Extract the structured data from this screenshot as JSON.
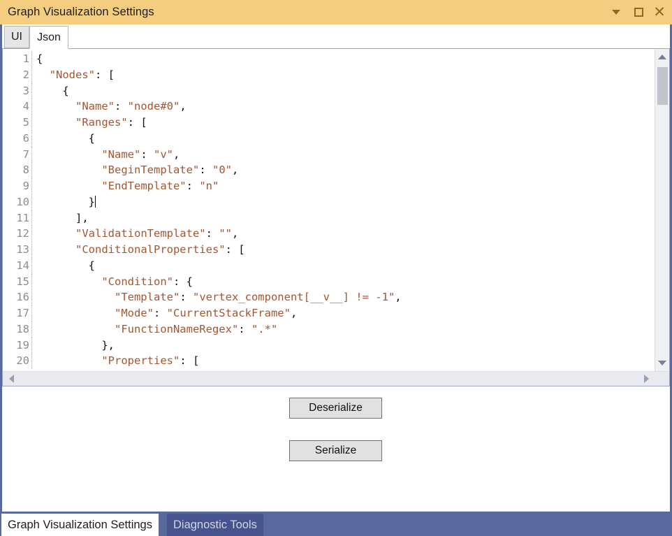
{
  "window": {
    "title": "Graph Visualization Settings",
    "controls": [
      {
        "name": "chevron-down-icon",
        "glyph": "▾"
      },
      {
        "name": "maximize-icon",
        "glyph": "□"
      },
      {
        "name": "close-icon",
        "glyph": "×"
      }
    ]
  },
  "tabs": {
    "items": [
      {
        "label": "UI",
        "active": false
      },
      {
        "label": "Json",
        "active": true
      }
    ]
  },
  "editor": {
    "lines": [
      {
        "num": "1",
        "segments": [
          {
            "t": "{",
            "k": "p"
          }
        ]
      },
      {
        "num": "2",
        "segments": [
          {
            "t": "  ",
            "k": "p"
          },
          {
            "t": "\"Nodes\"",
            "k": "s"
          },
          {
            "t": ": [",
            "k": "p"
          }
        ]
      },
      {
        "num": "3",
        "segments": [
          {
            "t": "    {",
            "k": "p"
          }
        ]
      },
      {
        "num": "4",
        "segments": [
          {
            "t": "      ",
            "k": "p"
          },
          {
            "t": "\"Name\"",
            "k": "s"
          },
          {
            "t": ": ",
            "k": "p"
          },
          {
            "t": "\"node#0\"",
            "k": "s"
          },
          {
            "t": ",",
            "k": "p"
          }
        ]
      },
      {
        "num": "5",
        "segments": [
          {
            "t": "      ",
            "k": "p"
          },
          {
            "t": "\"Ranges\"",
            "k": "s"
          },
          {
            "t": ": [",
            "k": "p"
          }
        ]
      },
      {
        "num": "6",
        "segments": [
          {
            "t": "        {",
            "k": "p"
          }
        ]
      },
      {
        "num": "7",
        "segments": [
          {
            "t": "          ",
            "k": "p"
          },
          {
            "t": "\"Name\"",
            "k": "s"
          },
          {
            "t": ": ",
            "k": "p"
          },
          {
            "t": "\"v\"",
            "k": "s"
          },
          {
            "t": ",",
            "k": "p"
          }
        ]
      },
      {
        "num": "8",
        "segments": [
          {
            "t": "          ",
            "k": "p"
          },
          {
            "t": "\"BeginTemplate\"",
            "k": "s"
          },
          {
            "t": ": ",
            "k": "p"
          },
          {
            "t": "\"0\"",
            "k": "s"
          },
          {
            "t": ",",
            "k": "p"
          }
        ]
      },
      {
        "num": "9",
        "segments": [
          {
            "t": "          ",
            "k": "p"
          },
          {
            "t": "\"EndTemplate\"",
            "k": "s"
          },
          {
            "t": ": ",
            "k": "p"
          },
          {
            "t": "\"n\"",
            "k": "s"
          }
        ]
      },
      {
        "num": "10",
        "segments": [
          {
            "t": "        }",
            "k": "p"
          }
        ],
        "caret": true
      },
      {
        "num": "11",
        "segments": [
          {
            "t": "      ],",
            "k": "p"
          }
        ]
      },
      {
        "num": "12",
        "segments": [
          {
            "t": "      ",
            "k": "p"
          },
          {
            "t": "\"ValidationTemplate\"",
            "k": "s"
          },
          {
            "t": ": ",
            "k": "p"
          },
          {
            "t": "\"\"",
            "k": "s"
          },
          {
            "t": ",",
            "k": "p"
          }
        ]
      },
      {
        "num": "13",
        "segments": [
          {
            "t": "      ",
            "k": "p"
          },
          {
            "t": "\"ConditionalProperties\"",
            "k": "s"
          },
          {
            "t": ": [",
            "k": "p"
          }
        ]
      },
      {
        "num": "14",
        "segments": [
          {
            "t": "        {",
            "k": "p"
          }
        ]
      },
      {
        "num": "15",
        "segments": [
          {
            "t": "          ",
            "k": "p"
          },
          {
            "t": "\"Condition\"",
            "k": "s"
          },
          {
            "t": ": {",
            "k": "p"
          }
        ]
      },
      {
        "num": "16",
        "segments": [
          {
            "t": "            ",
            "k": "p"
          },
          {
            "t": "\"Template\"",
            "k": "s"
          },
          {
            "t": ": ",
            "k": "p"
          },
          {
            "t": "\"vertex_component[__v__] != -1\"",
            "k": "s"
          },
          {
            "t": ",",
            "k": "p"
          }
        ]
      },
      {
        "num": "17",
        "segments": [
          {
            "t": "            ",
            "k": "p"
          },
          {
            "t": "\"Mode\"",
            "k": "s"
          },
          {
            "t": ": ",
            "k": "p"
          },
          {
            "t": "\"CurrentStackFrame\"",
            "k": "s"
          },
          {
            "t": ",",
            "k": "p"
          }
        ]
      },
      {
        "num": "18",
        "segments": [
          {
            "t": "            ",
            "k": "p"
          },
          {
            "t": "\"FunctionNameRegex\"",
            "k": "s"
          },
          {
            "t": ": ",
            "k": "p"
          },
          {
            "t": "\".*\"",
            "k": "s"
          }
        ]
      },
      {
        "num": "19",
        "segments": [
          {
            "t": "          },",
            "k": "p"
          }
        ]
      },
      {
        "num": "20",
        "segments": [
          {
            "t": "          ",
            "k": "p"
          },
          {
            "t": "\"Properties\"",
            "k": "s"
          },
          {
            "t": ": [",
            "k": "p"
          }
        ]
      }
    ]
  },
  "actions": {
    "deserialize_label": "Deserialize",
    "serialize_label": "Serialize"
  },
  "bottom_tabs": {
    "items": [
      {
        "label": "Graph Visualization Settings",
        "active": true
      },
      {
        "label": "Diagnostic Tools",
        "active": false
      }
    ]
  },
  "colors": {
    "titlebar": "#f5cd81",
    "window_border": "#5b6a9e",
    "bottom_bar": "#5b6a9e",
    "bottom_tab_inactive": "#46538c",
    "json_string": "#a4562f",
    "json_punctuation": "#111111",
    "gutter_text": "#8c8c8c",
    "button_face": "#e1e1e1"
  }
}
